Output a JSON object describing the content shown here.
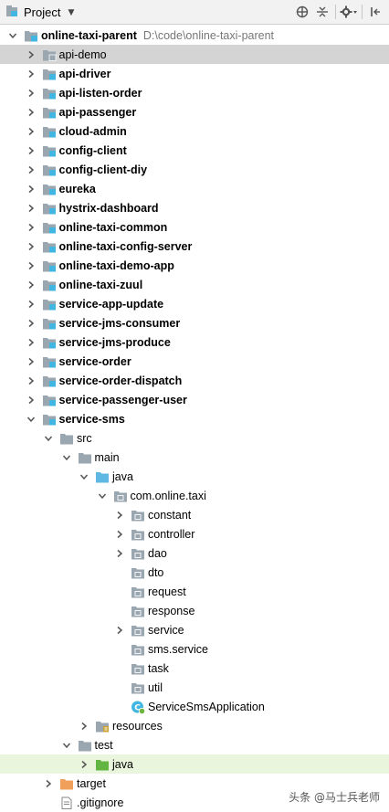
{
  "toolbar": {
    "title": "Project",
    "icons": [
      "globe-icon",
      "collapse-icon",
      "gear-icon",
      "hide-icon"
    ]
  },
  "tree": [
    {
      "label": "online-taxi-parent",
      "path": "D:\\code\\online-taxi-parent",
      "bold": true,
      "depth": 0,
      "expanded": true,
      "icon": "module"
    },
    {
      "label": "api-demo",
      "bold": false,
      "depth": 1,
      "expanded": false,
      "icon": "folder-module",
      "selected": true
    },
    {
      "label": "api-driver",
      "bold": true,
      "depth": 1,
      "expanded": false,
      "icon": "module"
    },
    {
      "label": "api-listen-order",
      "bold": true,
      "depth": 1,
      "expanded": false,
      "icon": "module"
    },
    {
      "label": "api-passenger",
      "bold": true,
      "depth": 1,
      "expanded": false,
      "icon": "module"
    },
    {
      "label": "cloud-admin",
      "bold": true,
      "depth": 1,
      "expanded": false,
      "icon": "module"
    },
    {
      "label": "config-client",
      "bold": true,
      "depth": 1,
      "expanded": false,
      "icon": "module"
    },
    {
      "label": "config-client-diy",
      "bold": true,
      "depth": 1,
      "expanded": false,
      "icon": "module"
    },
    {
      "label": "eureka",
      "bold": true,
      "depth": 1,
      "expanded": false,
      "icon": "module"
    },
    {
      "label": "hystrix-dashboard",
      "bold": true,
      "depth": 1,
      "expanded": false,
      "icon": "module"
    },
    {
      "label": "online-taxi-common",
      "bold": true,
      "depth": 1,
      "expanded": false,
      "icon": "module"
    },
    {
      "label": "online-taxi-config-server",
      "bold": true,
      "depth": 1,
      "expanded": false,
      "icon": "module"
    },
    {
      "label": "online-taxi-demo-app",
      "bold": true,
      "depth": 1,
      "expanded": false,
      "icon": "module"
    },
    {
      "label": "online-taxi-zuul",
      "bold": true,
      "depth": 1,
      "expanded": false,
      "icon": "module"
    },
    {
      "label": "service-app-update",
      "bold": true,
      "depth": 1,
      "expanded": false,
      "icon": "module"
    },
    {
      "label": "service-jms-consumer",
      "bold": true,
      "depth": 1,
      "expanded": false,
      "icon": "module"
    },
    {
      "label": "service-jms-produce",
      "bold": true,
      "depth": 1,
      "expanded": false,
      "icon": "module"
    },
    {
      "label": "service-order",
      "bold": true,
      "depth": 1,
      "expanded": false,
      "icon": "module"
    },
    {
      "label": "service-order-dispatch",
      "bold": true,
      "depth": 1,
      "expanded": false,
      "icon": "module"
    },
    {
      "label": "service-passenger-user",
      "bold": true,
      "depth": 1,
      "expanded": false,
      "icon": "module"
    },
    {
      "label": "service-sms",
      "bold": true,
      "depth": 1,
      "expanded": true,
      "icon": "module"
    },
    {
      "label": "src",
      "bold": false,
      "depth": 2,
      "expanded": true,
      "icon": "folder"
    },
    {
      "label": "main",
      "bold": false,
      "depth": 3,
      "expanded": true,
      "icon": "folder"
    },
    {
      "label": "java",
      "bold": false,
      "depth": 4,
      "expanded": true,
      "icon": "folder-src"
    },
    {
      "label": "com.online.taxi",
      "bold": false,
      "depth": 5,
      "expanded": true,
      "icon": "package"
    },
    {
      "label": "constant",
      "bold": false,
      "depth": 6,
      "expanded": false,
      "icon": "package"
    },
    {
      "label": "controller",
      "bold": false,
      "depth": 6,
      "expanded": false,
      "icon": "package"
    },
    {
      "label": "dao",
      "bold": false,
      "depth": 6,
      "expanded": false,
      "icon": "package"
    },
    {
      "label": "dto",
      "bold": false,
      "depth": 6,
      "expanded": null,
      "icon": "package"
    },
    {
      "label": "request",
      "bold": false,
      "depth": 6,
      "expanded": null,
      "icon": "package"
    },
    {
      "label": "response",
      "bold": false,
      "depth": 6,
      "expanded": null,
      "icon": "package"
    },
    {
      "label": "service",
      "bold": false,
      "depth": 6,
      "expanded": false,
      "icon": "package"
    },
    {
      "label": "sms.service",
      "bold": false,
      "depth": 6,
      "expanded": null,
      "icon": "package"
    },
    {
      "label": "task",
      "bold": false,
      "depth": 6,
      "expanded": null,
      "icon": "package"
    },
    {
      "label": "util",
      "bold": false,
      "depth": 6,
      "expanded": null,
      "icon": "package"
    },
    {
      "label": "ServiceSmsApplication",
      "bold": false,
      "depth": 6,
      "expanded": null,
      "icon": "spring-class"
    },
    {
      "label": "resources",
      "bold": false,
      "depth": 4,
      "expanded": false,
      "icon": "folder-res"
    },
    {
      "label": "test",
      "bold": false,
      "depth": 3,
      "expanded": true,
      "icon": "folder"
    },
    {
      "label": "java",
      "bold": false,
      "depth": 4,
      "expanded": false,
      "icon": "folder-test",
      "test": true
    },
    {
      "label": "target",
      "bold": false,
      "depth": 2,
      "expanded": false,
      "icon": "folder-target"
    },
    {
      "label": ".gitignore",
      "bold": false,
      "depth": 2,
      "expanded": null,
      "icon": "file"
    }
  ],
  "watermark": "头条 @马士兵老师",
  "colors": {
    "selection": "#d4d4d4",
    "test_row": "#e9f5dc",
    "folder_gray": "#9aa7b0",
    "module_blue": "#40b6e0",
    "source_blue": "#5fb8e4",
    "test_green": "#62b543",
    "target_orange": "#f0a05a"
  }
}
